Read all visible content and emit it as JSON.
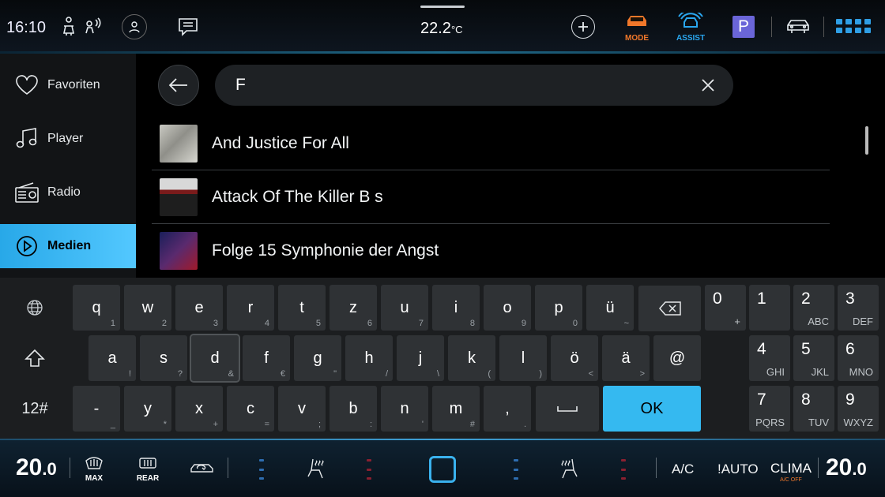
{
  "statusbar": {
    "time": "16:10",
    "outside_temp": "22.2",
    "outside_temp_unit": "°C",
    "mode_label": "MODE",
    "assist_label": "ASSIST",
    "parking_label": "P",
    "colors": {
      "mode": "#f0772a",
      "assist": "#2aa7f0",
      "parking": "#6a65d8",
      "accent": "#3ab2ee"
    }
  },
  "sidebar": {
    "items": [
      {
        "label": "Favoriten",
        "icon": "heart-icon",
        "active": false
      },
      {
        "label": "Player",
        "icon": "music-note-icon",
        "active": false
      },
      {
        "label": "Radio",
        "icon": "radio-icon",
        "active": false
      },
      {
        "label": "Medien",
        "icon": "play-icon",
        "active": true
      }
    ]
  },
  "search": {
    "value": "F"
  },
  "results": [
    {
      "title": "And Justice For All"
    },
    {
      "title": "Attack Of The Killer B s"
    },
    {
      "title": "Folge 15 Symphonie der Angst"
    }
  ],
  "keyboard": {
    "row1": [
      {
        "k": "q",
        "s": "1"
      },
      {
        "k": "w",
        "s": "2"
      },
      {
        "k": "e",
        "s": "3"
      },
      {
        "k": "r",
        "s": "4"
      },
      {
        "k": "t",
        "s": "5"
      },
      {
        "k": "z",
        "s": "6"
      },
      {
        "k": "u",
        "s": "7"
      },
      {
        "k": "i",
        "s": "8"
      },
      {
        "k": "o",
        "s": "9"
      },
      {
        "k": "p",
        "s": "0"
      },
      {
        "k": "ü",
        "s": "~"
      }
    ],
    "row2": [
      {
        "k": "a",
        "s": "!"
      },
      {
        "k": "s",
        "s": "?"
      },
      {
        "k": "d",
        "s": "&"
      },
      {
        "k": "f",
        "s": "€"
      },
      {
        "k": "g",
        "s": "\""
      },
      {
        "k": "h",
        "s": "/"
      },
      {
        "k": "j",
        "s": "\\"
      },
      {
        "k": "k",
        "s": "("
      },
      {
        "k": "l",
        "s": ")"
      },
      {
        "k": "ö",
        "s": "<"
      },
      {
        "k": "ä",
        "s": ">"
      },
      {
        "k": "@",
        "s": ""
      }
    ],
    "row3": [
      {
        "k": "-",
        "s": "_"
      },
      {
        "k": "y",
        "s": "*"
      },
      {
        "k": "x",
        "s": "+"
      },
      {
        "k": "c",
        "s": "="
      },
      {
        "k": "v",
        "s": ";"
      },
      {
        "k": "b",
        "s": ":"
      },
      {
        "k": "n",
        "s": "'"
      },
      {
        "k": "m",
        "s": "#"
      },
      {
        "k": ",",
        "s": "."
      }
    ],
    "numpad": [
      {
        "n": "0",
        "l": "+"
      },
      {
        "n": "1",
        "l": ""
      },
      {
        "n": "2",
        "l": "ABC"
      },
      {
        "n": "3",
        "l": "DEF"
      },
      {
        "n": "4",
        "l": "GHI"
      },
      {
        "n": "5",
        "l": "JKL"
      },
      {
        "n": "6",
        "l": "MNO"
      },
      {
        "n": "7",
        "l": "PQRS"
      },
      {
        "n": "8",
        "l": "TUV"
      },
      {
        "n": "9",
        "l": "WXYZ"
      }
    ],
    "ok_label": "OK",
    "symbols_label": "12#"
  },
  "climate": {
    "left_temp": "20",
    "left_temp_dec": ".0",
    "right_temp": "20",
    "right_temp_dec": ".0",
    "max_label": "MAX",
    "rear_label": "REAR",
    "ac_label": "A/C",
    "auto_label": "!AUTO",
    "clima_label": "CLIMA",
    "clima_sub": "A/C OFF"
  }
}
